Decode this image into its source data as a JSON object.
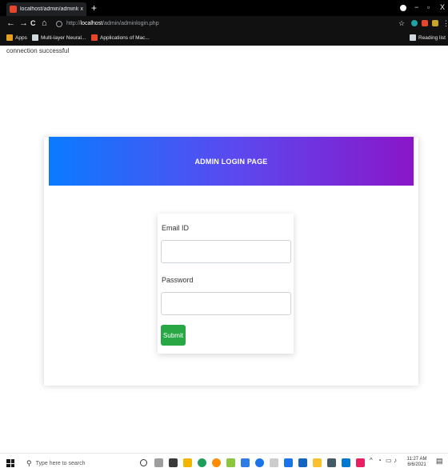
{
  "browser": {
    "tab_title": "localhost/admin/adminlogin.php",
    "tab_close": "x",
    "new_tab": "+",
    "minimize": "−",
    "restore": "▫",
    "close": "X",
    "back": "←",
    "forward": "→",
    "reload": "C",
    "home": "⌂",
    "url_prefix": "http://",
    "url_host": "localhost",
    "url_path": "/admin/adminlogin.php",
    "bookmarks": [
      "Apps",
      "Multi-layer Neural...",
      "Applications of Mac...",
      "Reading list"
    ]
  },
  "page": {
    "status_text": "connection successful",
    "card_title": "ADMIN LOGIN PAGE",
    "email_label": "Email ID",
    "email_value": "",
    "password_label": "Password",
    "password_value": "",
    "submit_label": "Submit"
  },
  "taskbar": {
    "search_placeholder": "Type here to search",
    "time": "11:27 AM",
    "date": "6/6/2021"
  },
  "colors": {
    "header_gradient_start": "#0a7bff",
    "header_gradient_end": "#8a16c8",
    "submit_button": "#28a745"
  }
}
